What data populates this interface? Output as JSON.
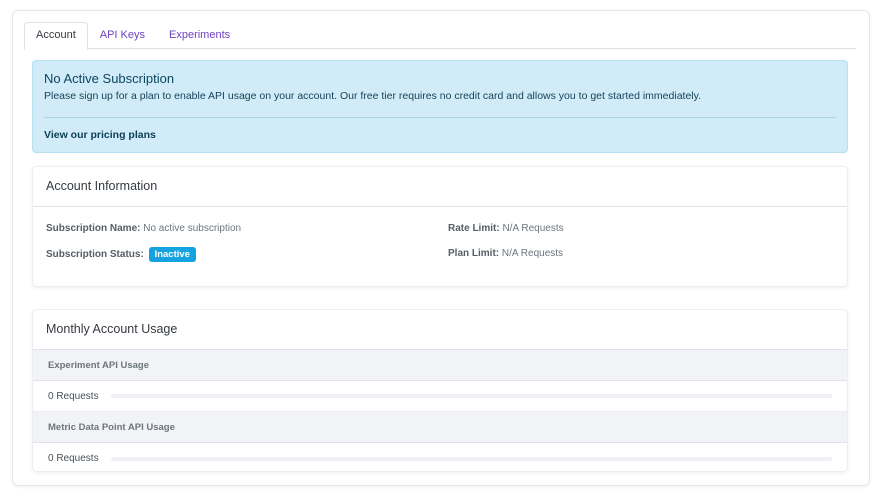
{
  "tabs": [
    {
      "label": "Account",
      "active": true
    },
    {
      "label": "API Keys",
      "active": false
    },
    {
      "label": "Experiments",
      "active": false
    }
  ],
  "alert": {
    "title": "No Active Subscription",
    "body": "Please sign up for a plan to enable API usage on your account. Our free tier requires no credit card and allows you to get started immediately.",
    "link": "View our pricing plans"
  },
  "account_info": {
    "title": "Account Information",
    "subscription_name_label": "Subscription Name:",
    "subscription_name_value": "No active subscription",
    "subscription_status_label": "Subscription Status:",
    "subscription_status_value": "Inactive",
    "rate_limit_label": "Rate Limit:",
    "rate_limit_value": "N/A Requests",
    "plan_limit_label": "Plan Limit:",
    "plan_limit_value": "N/A Requests"
  },
  "usage": {
    "title": "Monthly Account Usage",
    "sections": [
      {
        "heading": "Experiment API Usage",
        "requests": "0 Requests",
        "progress": 0
      },
      {
        "heading": "Metric Data Point API Usage",
        "requests": "0 Requests",
        "progress": 0
      }
    ]
  },
  "colors": {
    "accent": "#6f42c1",
    "info_bg": "#d1ecf8",
    "badge": "#14a3e0"
  }
}
